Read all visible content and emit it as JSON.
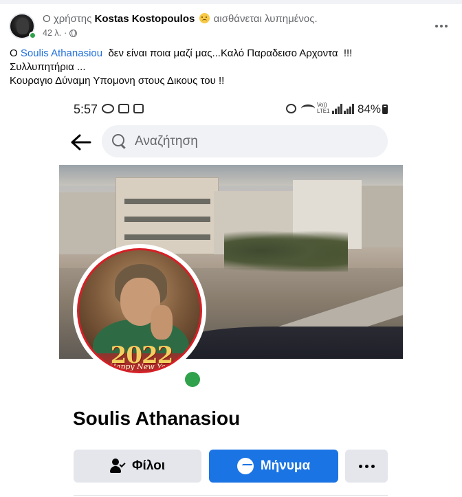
{
  "post": {
    "author_prefix": "Ο χρήστης",
    "author_name": "Kostas Kostopoulos",
    "feeling_text": "αισθάνεται λυπημένος.",
    "feeling_icon": "sad-face-icon",
    "time": "42 λ.",
    "separator": "·",
    "audience_icon": "globe-icon",
    "text": {
      "line1_prefix": "Ο",
      "mention": "Soulis Athanasiou",
      "line1_suffix": "δεν είναι ποια μαζί μας...Καλό Παραδεισο Αρχοντα  !!!",
      "line2": "Συλλυπητήρια ...",
      "line3": "Κουραγιο Δύναμη Υπομονη στους Δικους του !!"
    }
  },
  "screenshot": {
    "status_bar": {
      "time": "5:57",
      "network_label": "Vo)) LTE1",
      "battery": "84%"
    },
    "search": {
      "placeholder": "Αναζήτηση"
    },
    "profile": {
      "name": "Soulis Athanasiou",
      "badge_year": "2022",
      "badge_text": "Happy New Year"
    },
    "buttons": {
      "friends": "Φίλοι",
      "message": "Μήνυμα"
    }
  },
  "colors": {
    "mention": "#216fdb",
    "message_button": "#1b74e4",
    "online": "#31a24c",
    "secondary_text": "#65676b"
  }
}
